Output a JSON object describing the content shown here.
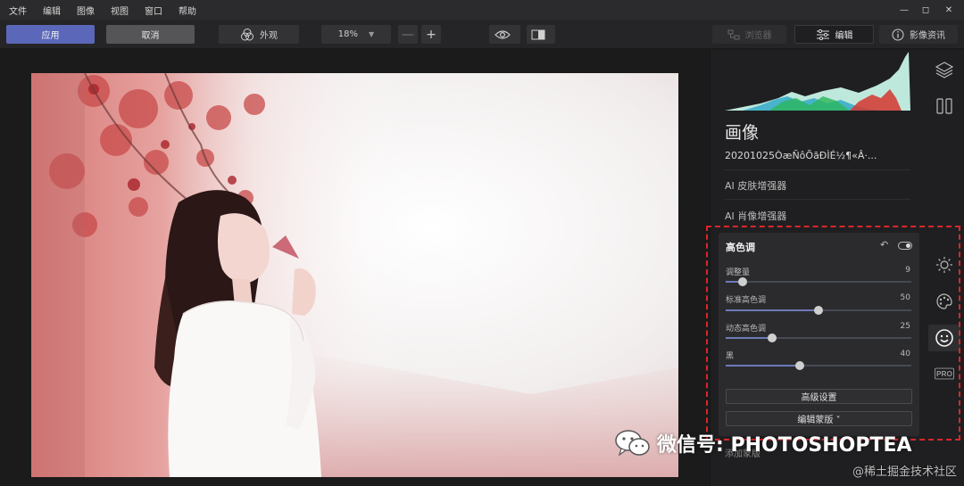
{
  "menu": [
    "文件",
    "编辑",
    "图像",
    "视图",
    "窗口",
    "帮助"
  ],
  "window_controls": {
    "minimize": "—",
    "maximize": "◻",
    "close": "✕"
  },
  "toolbar": {
    "apply": "应用",
    "cancel": "取消",
    "look": "外观",
    "zoom": "18%",
    "zoom_minus": "—",
    "zoom_plus": "+",
    "tabs": {
      "browse": "浏览器",
      "edit": "编辑",
      "info": "影像资讯"
    }
  },
  "panel": {
    "section_title": "画像",
    "filename": "20201025ÒæÑôÕãÐÌÉ½¶«Â·...",
    "plugins": [
      "AI 皮肤增强器",
      "AI 肖像增强器"
    ],
    "card": {
      "title": "高色调",
      "sliders": [
        {
          "label": "调整量",
          "value": 9
        },
        {
          "label": "标准高色调",
          "value": 50
        },
        {
          "label": "动态高色调",
          "value": 25
        },
        {
          "label": "黑",
          "value": 40
        }
      ],
      "advanced": "高级设置",
      "mask": "编辑蒙版 ˅"
    },
    "ghost_label": "添加蒙版"
  },
  "sidetools": [
    "layers-icon",
    "compare-panel-icon",
    "sun-icon",
    "palette-icon",
    "smile-icon",
    "pro-icon"
  ],
  "sidetools_labels": {
    "pro": "PRO"
  },
  "overlay": {
    "watermark": "微信号: PHOTOSHOPTEA",
    "credit": "@稀土掘金技术社区"
  },
  "colors": {
    "accent": "#5b67b8",
    "highlight_border": "#d9262b",
    "panel_bg": "#1f1f21"
  }
}
